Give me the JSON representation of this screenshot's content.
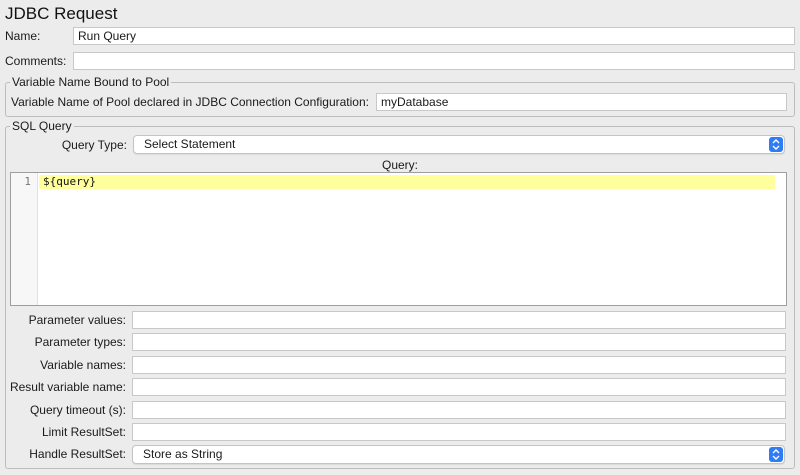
{
  "panel": {
    "title": "JDBC Request"
  },
  "name": {
    "label": "Name:",
    "value": "Run Query"
  },
  "comments": {
    "label": "Comments:",
    "value": ""
  },
  "pool_group": {
    "title": "Variable Name Bound to Pool",
    "label": "Variable Name of Pool declared in JDBC Connection Configuration:",
    "value": "myDatabase"
  },
  "sql_group": {
    "title": "SQL Query",
    "query_type_label": "Query Type:",
    "query_type_value": "Select Statement",
    "query_label": "Query:",
    "editor": {
      "line_number": "1",
      "code": "${query}"
    }
  },
  "params": {
    "parameter_values": {
      "label": "Parameter values:",
      "value": ""
    },
    "parameter_types": {
      "label": "Parameter types:",
      "value": ""
    },
    "variable_names": {
      "label": "Variable names:",
      "value": ""
    },
    "result_variable_name": {
      "label": "Result variable name:",
      "value": ""
    },
    "query_timeout": {
      "label": "Query timeout (s):",
      "value": ""
    },
    "limit_resultset": {
      "label": "Limit ResultSet:",
      "value": ""
    },
    "handle_resultset": {
      "label": "Handle ResultSet:",
      "value": "Store as String"
    }
  },
  "colors": {
    "background": "#ececec",
    "accent": "#2e7cf6",
    "editor_highlight": "#ffff9c"
  },
  "icons": {
    "select_arrows": "updown-chevron-icon"
  }
}
